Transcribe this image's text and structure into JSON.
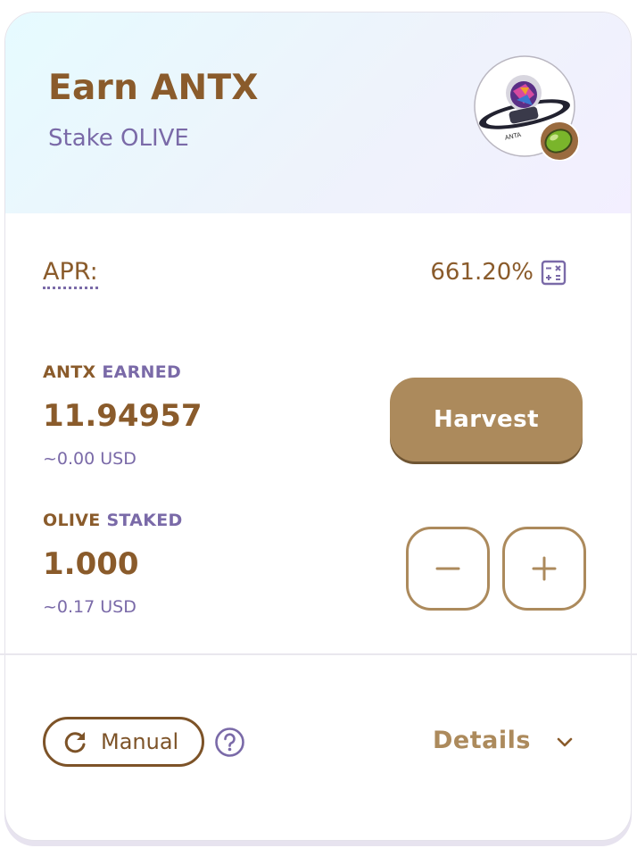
{
  "header": {
    "title": "Earn ANTX",
    "subtitle": "Stake OLIVE",
    "earn_token_icon": "antx-token-icon",
    "stake_token_icon": "olive-token-icon"
  },
  "apr": {
    "label": "APR:",
    "value": "661.20%",
    "icon": "calculator-icon"
  },
  "earned": {
    "token": "ANTX",
    "word": "EARNED",
    "amount": "11.94957",
    "usd": "~0.00 USD",
    "harvest_label": "Harvest"
  },
  "staked": {
    "token": "OLIVE",
    "word": "STAKED",
    "amount": "1.000",
    "usd": "~0.17 USD",
    "minus_icon": "minus-icon",
    "plus_icon": "plus-icon"
  },
  "footer": {
    "manual_label": "Manual",
    "details_label": "Details"
  },
  "colors": {
    "brown": "#8a5b2b",
    "purple": "#7a6aa8",
    "button": "#ac8a5c"
  }
}
